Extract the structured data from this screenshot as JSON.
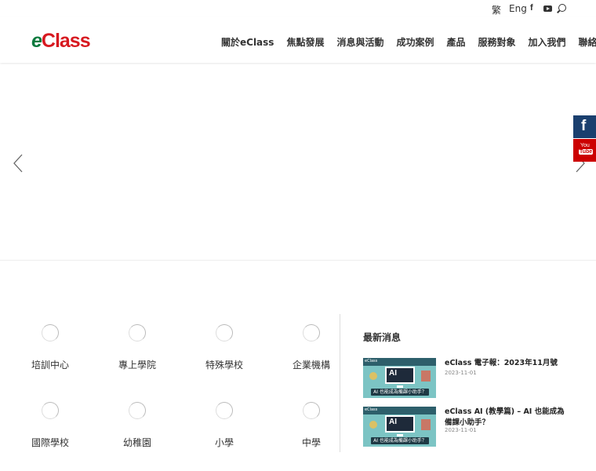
{
  "topbar": {
    "lang_zh": "繁",
    "lang_en": "Eng",
    "facebook_glyph": "f"
  },
  "header": {
    "logo_e": "e",
    "logo_rest": "Class",
    "nav": [
      "關於eClass",
      "焦點發展",
      "消息與活動",
      "成功案例",
      "產品",
      "服務對象",
      "加入我們",
      "聯絡我們"
    ]
  },
  "side_social": {
    "facebook_glyph": "f",
    "youtube_you": "You",
    "youtube_tube": "Tube"
  },
  "categories": [
    "培訓中心",
    "專上學院",
    "特殊學校",
    "企業機構",
    "國際學校",
    "幼稚園",
    "小學",
    "中學"
  ],
  "news": {
    "title": "最新消息",
    "items": [
      {
        "headline": "eClass 電子報：2023年11月號",
        "date": "2023-11-01",
        "thumb_tag": "eClass",
        "thumb_ai": "AI",
        "thumb_caption": "AI 也能成為備課小助手？"
      },
      {
        "headline": "eClass AI (教學篇) – AI 也能成為備課小助手？",
        "date": "2023-11-01",
        "thumb_tag": "eClass",
        "thumb_ai": "AI",
        "thumb_caption": "AI 也能成為備課小助手？"
      }
    ]
  },
  "colors": {
    "logo_green": "#0d7a3e",
    "logo_red": "#d71920",
    "facebook_blue": "#1a3f6e",
    "youtube_red": "#cc0000"
  },
  "icons": [
    "facebook-icon",
    "youtube-icon",
    "search-icon",
    "chevron-left-icon",
    "chevron-right-icon",
    "category-circle-icon"
  ]
}
